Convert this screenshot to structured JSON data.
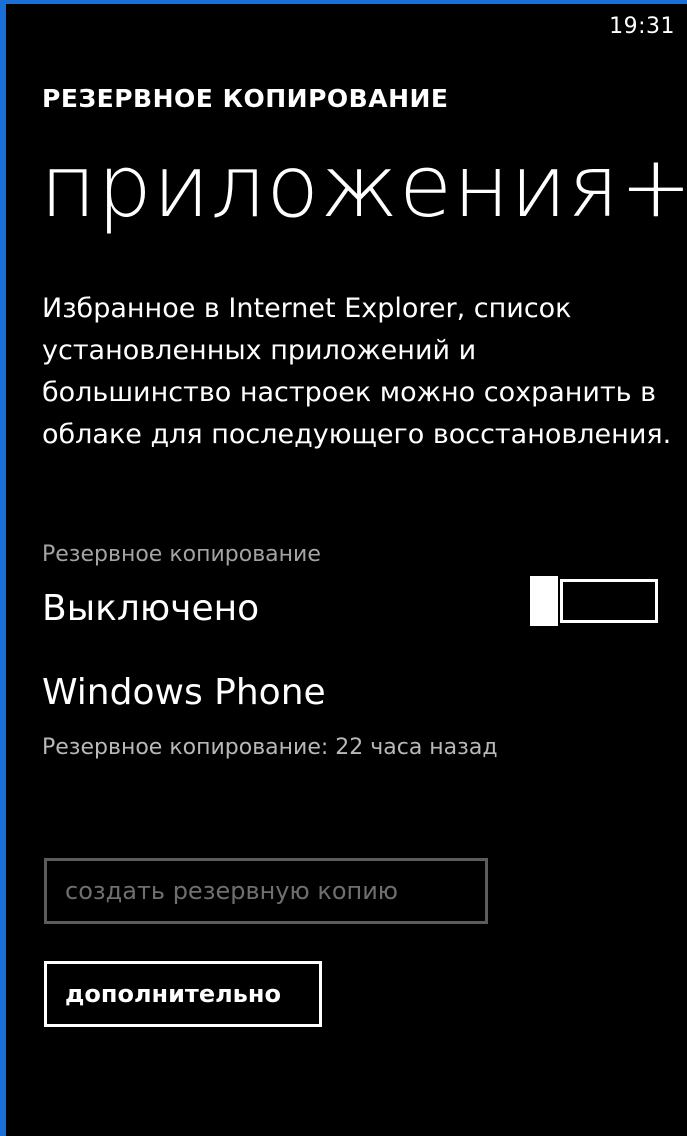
{
  "status_bar": {
    "time": "19:31"
  },
  "header": {
    "app_title": "РЕЗЕРВНОЕ КОПИРОВАНИЕ",
    "page_title": "приложения+настройки"
  },
  "description": "Избранное в Internet Explorer, список установленных приложений и большинство настроек можно сохранить в облаке для последующего восстановления.",
  "backup_toggle": {
    "caption": "Резервное копирование",
    "state_label": "Выключено",
    "is_on": false
  },
  "service": {
    "name": "Windows Phone",
    "last_backup": "Резервное копирование: 22 часа назад"
  },
  "buttons": {
    "create_backup": "создать резервную копию",
    "advanced": "дополнительно"
  },
  "colors": {
    "accent": "#1a6fd6",
    "background": "#000000",
    "disabled": "#5c5c5c"
  }
}
